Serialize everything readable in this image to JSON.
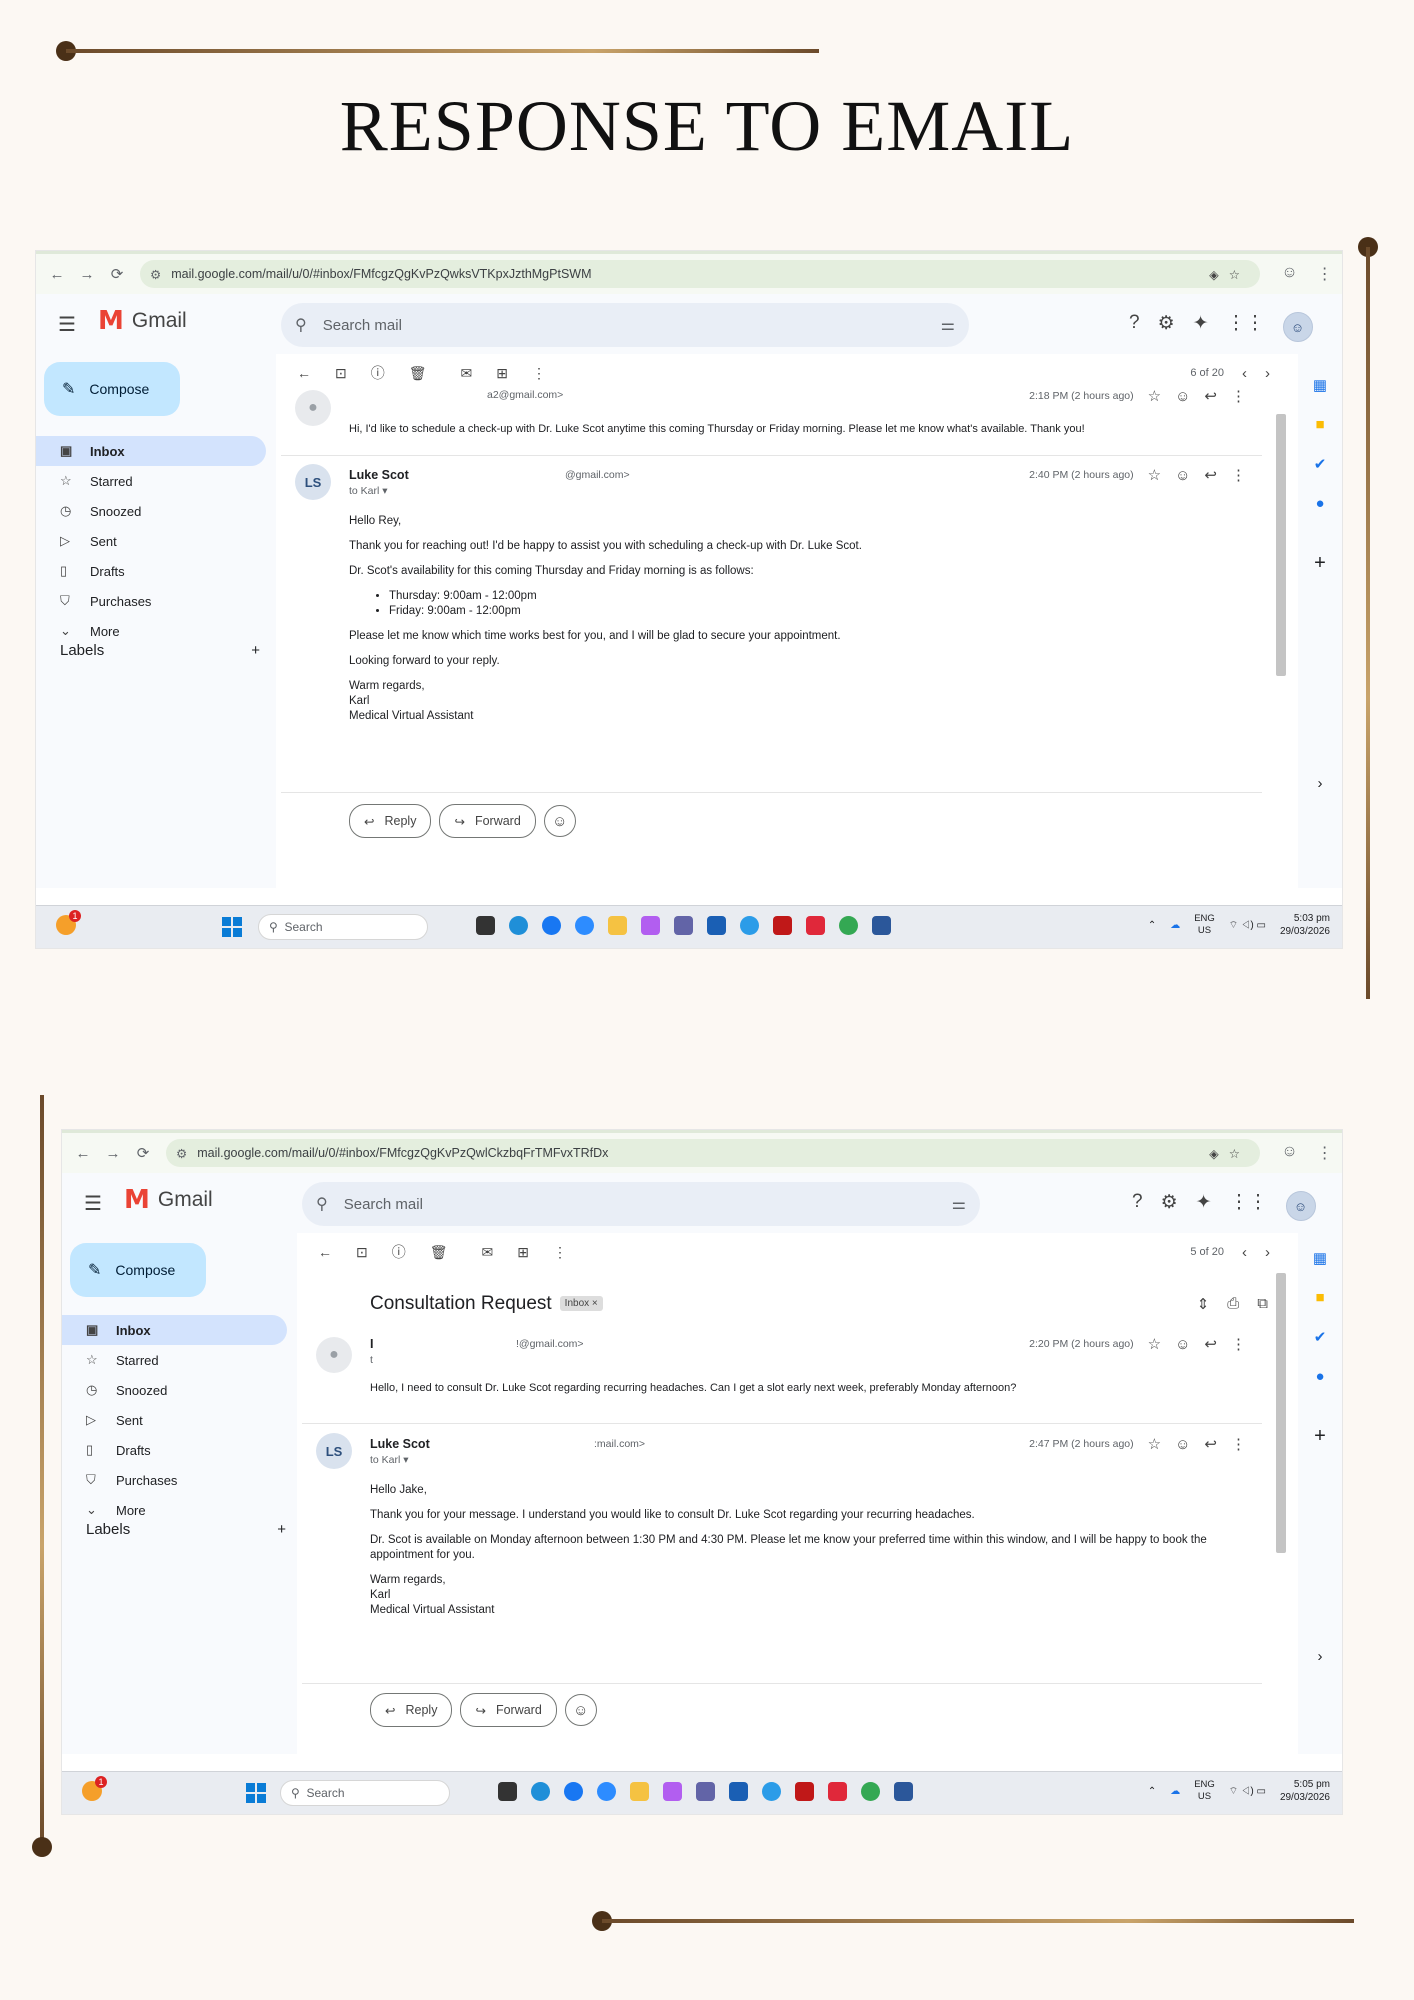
{
  "page": {
    "title": "RESPONSE TO EMAIL"
  },
  "shot1": {
    "url": "mail.google.com/mail/u/0/#inbox/FMfcgzQgKvPzQwksVTKpxJzthMgPtSWM",
    "gmail_label": "Gmail",
    "search_placeholder": "Search mail",
    "compose_label": "Compose",
    "nav": [
      {
        "icon": "▣",
        "label": "Inbox"
      },
      {
        "icon": "☆",
        "label": "Starred"
      },
      {
        "icon": "◷",
        "label": "Snoozed"
      },
      {
        "icon": "▷",
        "label": "Sent"
      },
      {
        "icon": "▯",
        "label": "Drafts"
      },
      {
        "icon": "⛉",
        "label": "Purchases"
      },
      {
        "icon": "⌄",
        "label": "More"
      }
    ],
    "labels_heading": "Labels",
    "pager": "6 of 20",
    "msg1": {
      "email": "a2@gmail.com>",
      "time": "2:18 PM (2 hours ago)",
      "body": "Hi, I'd like to schedule a check-up with Dr. Luke Scot anytime this coming Thursday or Friday morning. Please let me know what's available. Thank you!"
    },
    "msg2": {
      "sender": "Luke Scot",
      "email": "@gmail.com>",
      "to": "to Karl",
      "time": "2:40 PM (2 hours ago)",
      "p1": "Hello Rey,",
      "p2": "Thank you for reaching out! I'd be happy to assist you with scheduling a check-up with Dr. Luke Scot.",
      "p3": "Dr. Scot's availability for this coming Thursday and Friday morning is as follows:",
      "li1": "Thursday: 9:00am - 12:00pm",
      "li2": "Friday: 9:00am - 12:00pm",
      "p4": "Please let me know which time works best for you, and I will be glad to secure your appointment.",
      "p5": "Looking forward to your reply.",
      "sig1": "Warm regards,",
      "sig2": "Karl",
      "sig3": "Medical Virtual Assistant"
    },
    "reply_label": "Reply",
    "forward_label": "Forward",
    "taskbar": {
      "search": "Search",
      "lang1": "ENG",
      "lang2": "US",
      "time": "5:03 pm",
      "date": "29/03/2026"
    }
  },
  "shot2": {
    "url": "mail.google.com/mail/u/0/#inbox/FMfcgzQgKvPzQwlCkzbqFrTMFvxTRfDx",
    "gmail_label": "Gmail",
    "search_placeholder": "Search mail",
    "compose_label": "Compose",
    "nav": [
      {
        "icon": "▣",
        "label": "Inbox"
      },
      {
        "icon": "☆",
        "label": "Starred"
      },
      {
        "icon": "◷",
        "label": "Snoozed"
      },
      {
        "icon": "▷",
        "label": "Sent"
      },
      {
        "icon": "▯",
        "label": "Drafts"
      },
      {
        "icon": "⛉",
        "label": "Purchases"
      },
      {
        "icon": "⌄",
        "label": "More"
      }
    ],
    "labels_heading": "Labels",
    "pager": "5 of 20",
    "thread_title": "Consultation Request",
    "thread_badge": "Inbox ×",
    "msg1": {
      "sender": "I",
      "email": "!@gmail.com>",
      "to": "t",
      "time": "2:20 PM (2 hours ago)",
      "body": "Hello, I need to consult Dr. Luke Scot regarding recurring headaches. Can I get a slot early next week, preferably Monday afternoon?"
    },
    "msg2": {
      "sender": "Luke Scot",
      "email": ":mail.com>",
      "to": "to Karl",
      "time": "2:47 PM (2 hours ago)",
      "p1": "Hello Jake,",
      "p2": "Thank you for your message. I understand you would like to consult Dr. Luke Scot regarding your recurring headaches.",
      "p3": "Dr. Scot is available on Monday afternoon between 1:30 PM and 4:30 PM. Please let me know your preferred time within this window, and I will be happy to book the appointment for you.",
      "sig1": "Warm regards,",
      "sig2": "Karl",
      "sig3": "Medical Virtual Assistant"
    },
    "reply_label": "Reply",
    "forward_label": "Forward",
    "taskbar": {
      "search": "Search",
      "lang1": "ENG",
      "lang2": "US",
      "time": "5:05 pm",
      "date": "29/03/2026"
    }
  },
  "colors": {
    "accent": "#c2e7ff",
    "active_nav": "#d3e3fd",
    "deco": "#6b4a2a",
    "background": "#fcf8f3"
  }
}
